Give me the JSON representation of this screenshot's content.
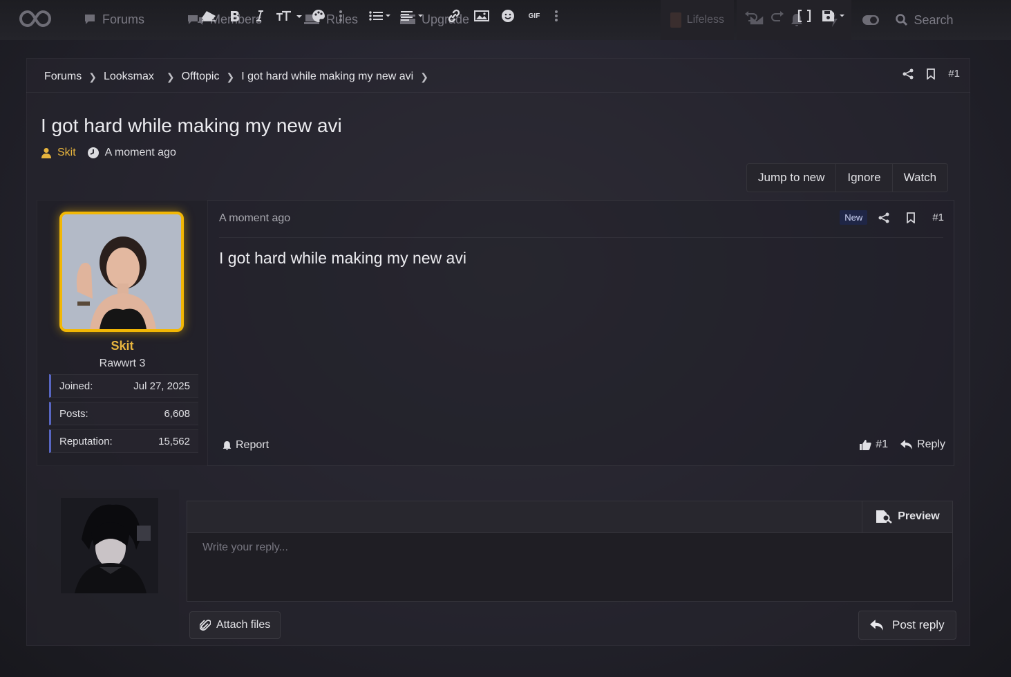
{
  "nav": {
    "items": [
      {
        "label": "Forums",
        "icon": "forum-icon"
      },
      {
        "label": "Members",
        "icon": "members-icon"
      },
      {
        "label": "Rules",
        "icon": "rules-icon"
      },
      {
        "label": "Upgrade",
        "icon": "card-icon"
      }
    ],
    "user_label": "Lifeless",
    "search_label": "Search"
  },
  "breadcrumb": {
    "items": [
      "Forums",
      "Looksmax",
      "Offtopic",
      "I got hard while making my new avi"
    ],
    "post_number": "#1"
  },
  "thread": {
    "title": "I got hard while making my new avi",
    "author": "Skit",
    "time": "A moment ago",
    "buttons": {
      "jump": "Jump to new",
      "ignore": "Ignore",
      "watch": "Watch"
    }
  },
  "post": {
    "time": "A moment ago",
    "badge": "New",
    "number": "#1",
    "body": "I got hard while making my new avi",
    "report_label": "Report",
    "like_label": "#1",
    "reply_label": "Reply",
    "user": {
      "name": "Skit",
      "title": "Rawwrt 3",
      "stats": [
        {
          "label": "Joined:",
          "value": "Jul 27, 2025"
        },
        {
          "label": "Posts:",
          "value": "6,608"
        },
        {
          "label": "Reputation:",
          "value": "15,562"
        }
      ]
    }
  },
  "reply": {
    "placeholder": "Write your reply...",
    "preview_label": "Preview",
    "attach_label": "Attach files",
    "post_label": "Post reply",
    "gif_label": "GIF"
  },
  "colors": {
    "accent_gold": "#f2b705",
    "author_color": "#e8b53e",
    "stat_bar": "#5866c2"
  }
}
